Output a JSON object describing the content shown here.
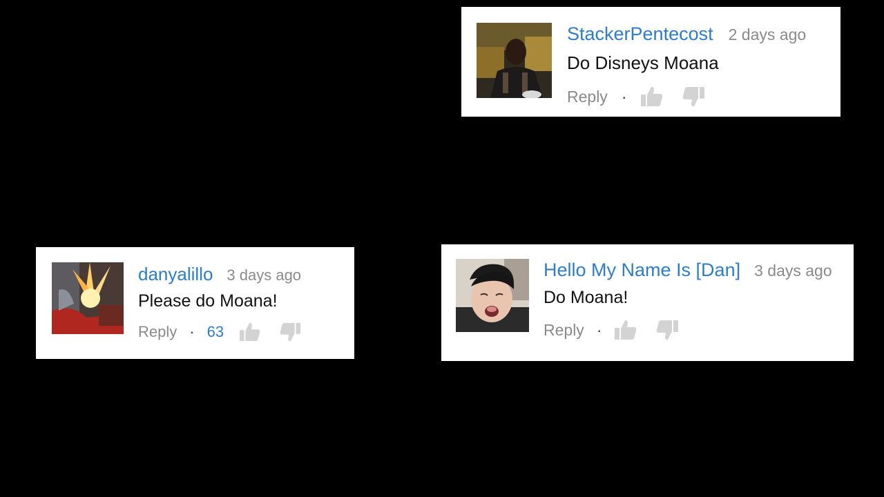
{
  "comments": [
    {
      "author": "StackerPentecost",
      "time": "2 days ago",
      "text": "Do Disneys Moana",
      "reply_label": "Reply",
      "separator": "·",
      "likes": "",
      "like_icon": "thumbs-up-icon",
      "dislike_icon": "thumbs-down-icon"
    },
    {
      "author": "danyalillo",
      "time": "3 days ago",
      "text": "Please do Moana!",
      "reply_label": "Reply",
      "separator": "·",
      "likes": "63",
      "like_icon": "thumbs-up-icon",
      "dislike_icon": "thumbs-down-icon"
    },
    {
      "author": "Hello My Name Is [Dan]",
      "time": "3 days ago",
      "text": "Do Moana!",
      "reply_label": "Reply",
      "separator": "·",
      "likes": "",
      "like_icon": "thumbs-up-icon",
      "dislike_icon": "thumbs-down-icon"
    }
  ],
  "colors": {
    "background": "#000000",
    "card": "#ffffff",
    "author": "#2f7dc8",
    "meta": "#8a8a8a",
    "icon": "#d3d3d3"
  }
}
